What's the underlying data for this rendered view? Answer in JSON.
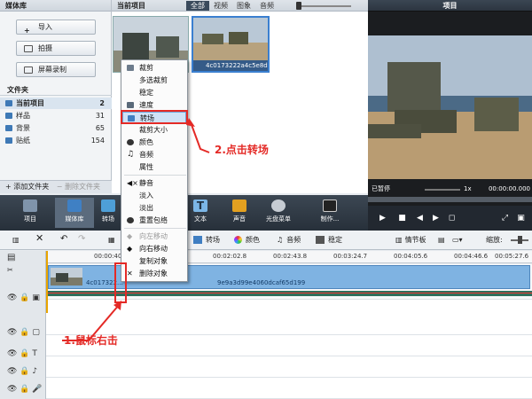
{
  "library": {
    "title": "媒体库",
    "buttons": [
      "导入",
      "拍摄",
      "屏幕录制"
    ],
    "folders_title": "文件夹",
    "folders": [
      {
        "name": "当前项目",
        "count": "2"
      },
      {
        "name": "样品",
        "count": "31"
      },
      {
        "name": "背景",
        "count": "65"
      },
      {
        "name": "贴纸",
        "count": "154"
      }
    ],
    "add_folder": "添加文件夹",
    "delete_folder": "删除文件夹"
  },
  "project": {
    "title": "当前项目",
    "tabs": [
      "全部",
      "视频",
      "图象",
      "音频"
    ],
    "clip2_name": "4c0173222a4c5e8d1..."
  },
  "preview": {
    "title": "项目",
    "status": "已暂停",
    "speed": "1x",
    "time": "00:00:00.000"
  },
  "toolbar": {
    "items": [
      "项目",
      "媒体库",
      "转场",
      "文本",
      "声音",
      "光盘菜单",
      "制作..."
    ]
  },
  "editbar": {
    "transition": "转场",
    "color": "颜色",
    "audio": "音频",
    "stabilize": "稳定",
    "storyboard": "情节板",
    "zoom": "缩放:"
  },
  "timeline": {
    "ticks": [
      "00:00:40.9",
      "00:02:02.8",
      "00:02:43.8",
      "00:03:24.7",
      "00:04:05.6",
      "00:04:46.6",
      "00:05:27.6"
    ],
    "clip1_name": "4c017322...",
    "clip2_name": "9e9a3d99e4060dcaf65d199"
  },
  "context_menu": {
    "items": [
      "裁剪",
      "多选裁剪",
      "稳定",
      "速度",
      "转场",
      "裁剪大小",
      "颜色",
      "音频",
      "属性",
      "静音",
      "淡入",
      "淡出",
      "重置包络",
      "向左移动",
      "向右移动",
      "复制对象",
      "删除对象"
    ],
    "highlighted": "转场"
  },
  "annotations": {
    "step1": "1.鼠标右击",
    "step2": "2.点击转场"
  },
  "colors": {
    "accent": "#3a7fd0",
    "annotation": "#e42a26",
    "toolbar": "#2f3945"
  }
}
